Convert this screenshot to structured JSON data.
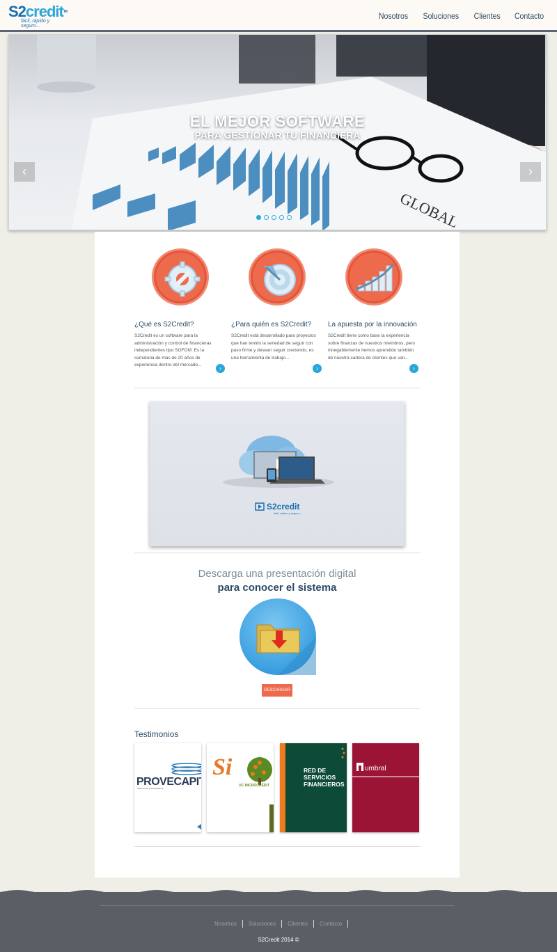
{
  "header": {
    "logo_s2": "S2",
    "logo_credit": "credit",
    "logo_tm": "TM",
    "logo_tagline": "fácil, rápido y seguro...",
    "nav": [
      "Nosotros",
      "Soluciones",
      "Clientes",
      "Contacto"
    ]
  },
  "hero": {
    "title": "EL MEJOR SOFTWARE",
    "subtitle": "PARA GESTIONAR TU FINANCIERA",
    "prev": "‹",
    "next": "›",
    "slides": 5,
    "active_slide": 1,
    "banner_text": "GLOBAL"
  },
  "features": [
    {
      "icon": "gear-wrench-icon",
      "title": "¿Qué es S2Credit?",
      "text": "S2Credit es un software para la administración y control de financieras independientes tipo SOFOM. Es la sumatoria de más de 20 años de experiencia dentro del mercado..."
    },
    {
      "icon": "target-icon",
      "title": "¿Para quién es S2Credit?",
      "text": "S2Credit está desarrollado para proyectos que han tenido la seriedad de seguir con paso firme y desean seguir creciendo, es una herramienta de trabajo..."
    },
    {
      "icon": "growth-chart-icon",
      "title": "La apuesta por la innovación",
      "text": "S2Credit tiene como base la experiencia sobre finanzas de nuestros miembros, pero innegablemente hemos aprendido también de nuestra cartera de clientes que van..."
    }
  ],
  "more_label": "›",
  "video": {
    "logo": "S2credit",
    "tagline": "fácil, rápido y seguro..."
  },
  "download": {
    "line1": "Descarga una presentación digital",
    "line2": "para conocer el sistema",
    "button": "DESCARGAR"
  },
  "testimonials": {
    "title": "Testimonios",
    "items": [
      {
        "name": "PROVECAPITAL",
        "sub": "SERVICIOS FINANCIEROS"
      },
      {
        "name": "Si",
        "sub": "UC MICROCRÉDIT"
      },
      {
        "name": "RED DE SERVICIOS FINANCIEROS"
      },
      {
        "name": "umbral"
      }
    ]
  },
  "footer": {
    "nav": [
      "Nosotros",
      "Soluciones",
      "Clientes",
      "Contacto"
    ],
    "copyright": "S2Credit 2014 ©"
  },
  "colors": {
    "accent": "#29a7d9",
    "brand": "#1a6fb0",
    "coral": "#ee6a4d",
    "footer": "#5a5f66"
  }
}
